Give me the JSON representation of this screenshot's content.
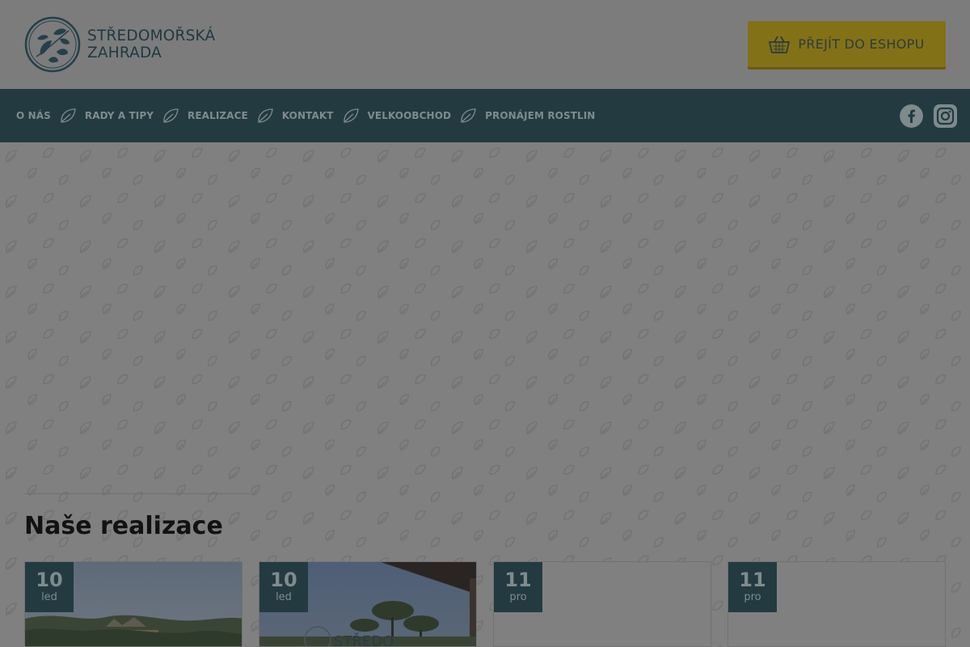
{
  "header": {
    "logo_line1": "STŘEDOMOŘSKÁ",
    "logo_line2": "ZAHRADA",
    "eshop_label": "PŘEJÍT DO ESHOPU"
  },
  "nav": {
    "items": [
      {
        "label": "O NÁS"
      },
      {
        "label": "RADY A TIPY"
      },
      {
        "label": "REALIZACE"
      },
      {
        "label": "KONTAKT"
      },
      {
        "label": "VELKOOBCHOD"
      },
      {
        "label": "PRONÁJEM ROSTLIN"
      }
    ]
  },
  "social": {
    "icons": [
      "facebook-icon",
      "instagram-icon"
    ]
  },
  "section": {
    "title": "Naše realizace"
  },
  "cards": [
    {
      "day": "10",
      "month": "led",
      "watermark": ""
    },
    {
      "day": "10",
      "month": "led",
      "watermark": "STŘEDO"
    },
    {
      "day": "11",
      "month": "pro",
      "watermark": ""
    },
    {
      "day": "11",
      "month": "pro",
      "watermark": ""
    }
  ],
  "colors": {
    "overlay": "#7c7c7c",
    "nav_bg": "#233a41",
    "accent": "#837117",
    "text_dark": "#1f3841"
  }
}
